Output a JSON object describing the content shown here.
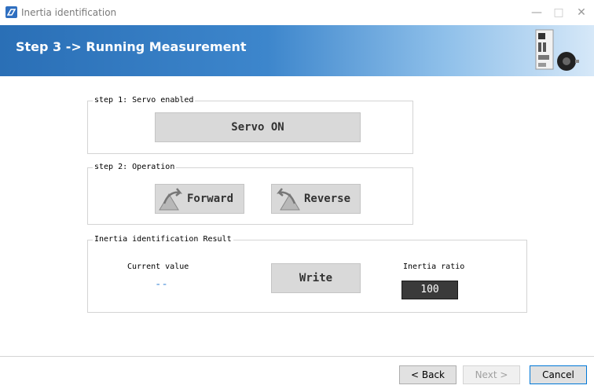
{
  "window": {
    "title": "Inertia identification",
    "minimize": "—",
    "maximize": "□",
    "close": "✕"
  },
  "header": {
    "step_title": "Step 3 -> Running Measurement"
  },
  "step1": {
    "label": "step 1: Servo enabled",
    "servo_on": "Servo ON"
  },
  "step2": {
    "label": "step 2: Operation",
    "forward": "Forward",
    "reverse": "Reverse"
  },
  "result": {
    "label": "Inertia identification Result",
    "current_label": "Current value",
    "current_value": "--",
    "write": "Write",
    "ratio_label": "Inertia ratio",
    "ratio_value": "100"
  },
  "nav": {
    "back": "< Back",
    "next": "Next >",
    "cancel": "Cancel"
  },
  "colors": {
    "header_start": "#2a6fb6",
    "header_end": "#d6e8f8",
    "current_value": "#4a90d9",
    "ratio_bg": "#3a3a3a"
  }
}
